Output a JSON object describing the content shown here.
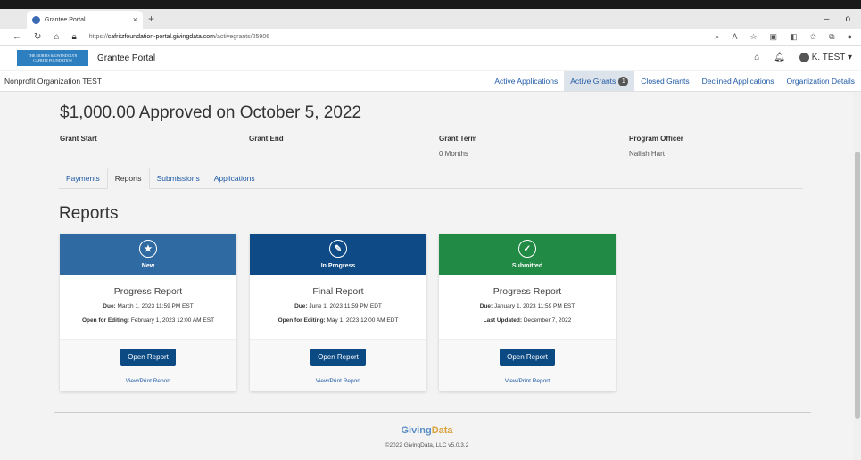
{
  "browser": {
    "tab_title": "Grantee Portal",
    "tab_close": "×",
    "new_tab": "+",
    "url_prefix": "https://",
    "url_domain": "cafritzfoundation-portal.givingdata.com",
    "url_path": "/activegrants/25906",
    "minimize": "–",
    "restore": "o"
  },
  "app": {
    "logo_line1": "THE MORRIS & GWENDOLYN",
    "logo_line2": "CAFRITZ FOUNDATION",
    "portal_title": "Grantee Portal",
    "user_name": "K. TEST ▾"
  },
  "org": {
    "name": "Nonprofit Organization TEST",
    "tabs": {
      "active_applications": "Active Applications",
      "active_grants": "Active Grants",
      "active_grants_count": "1",
      "closed_grants": "Closed Grants",
      "declined_applications": "Declined Applications",
      "organization_details": "Organization Details"
    }
  },
  "grant": {
    "title": "$1,000.00 Approved on October 5, 2022",
    "start_label": "Grant Start",
    "end_label": "Grant End",
    "term_label": "Grant Term",
    "term_value": "0 Months",
    "officer_label": "Program Officer",
    "officer_value": "Naliah Hart"
  },
  "subtabs": {
    "payments": "Payments",
    "reports": "Reports",
    "submissions": "Submissions",
    "applications": "Applications"
  },
  "section_title": "Reports",
  "cards": [
    {
      "status": "New",
      "color": "#2f6aa3",
      "icon": "star-icon",
      "name": "Progress Report",
      "due_label": "Due:",
      "due_value": "March 1, 2023 11:59 PM EST",
      "second_label": "Open for Editing:",
      "second_value": "February 1, 2023 12:00 AM EST",
      "button": "Open Report",
      "link": "View/Print Report"
    },
    {
      "status": "In Progress",
      "color": "#0d4a86",
      "icon": "pencil-icon",
      "name": "Final Report",
      "due_label": "Due:",
      "due_value": "June 1, 2023 11:59 PM EDT",
      "second_label": "Open for Editing:",
      "second_value": "May 1, 2023 12:00 AM EDT",
      "button": "Open Report",
      "link": "View/Print Report"
    },
    {
      "status": "Submitted",
      "color": "#218a45",
      "icon": "check-icon",
      "name": "Progress Report",
      "due_label": "Due:",
      "due_value": "January 1, 2023 11:59 PM EST",
      "second_label": "Last Updated:",
      "second_value": "December 7, 2022",
      "button": "Open Report",
      "link": "View/Print Report"
    }
  ],
  "footer": {
    "logo_giving": "Giving",
    "logo_data": "Data",
    "copyright": "©2022 GivingData, LLC v5.0.3.2"
  }
}
